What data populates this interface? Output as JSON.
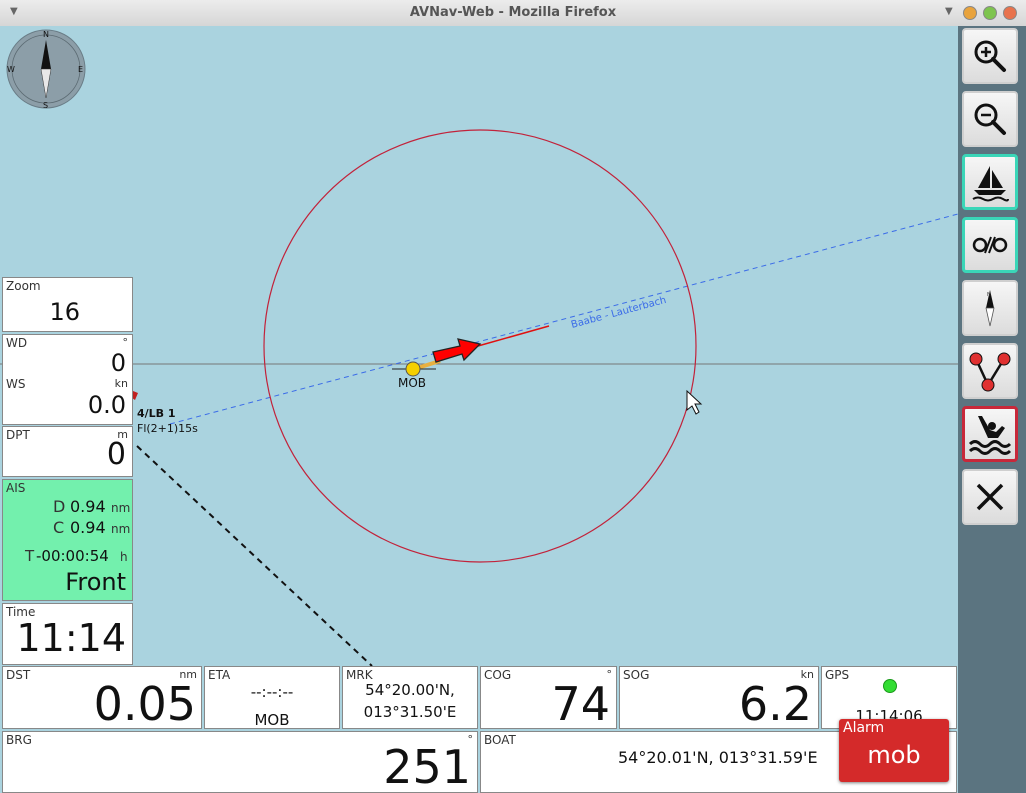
{
  "window": {
    "title": "AVNav-Web - Mozilla Firefox"
  },
  "map": {
    "route_label": "Baabe - Lauterbach",
    "mob_label": "MOB",
    "buoy_name": "4/LB 1",
    "buoy_light": "Fl(2+1)15s",
    "compass_letters": {
      "n": "N",
      "e": "E",
      "s": "S",
      "w": "W"
    },
    "colors": {
      "water": "#aad3df",
      "circle": "#c2223a",
      "route": "#3b6ce8",
      "boat": "#ff0000",
      "mob": "#f5d000"
    }
  },
  "toolbar": [
    {
      "icon": "zoom-in-icon",
      "state": "normal"
    },
    {
      "icon": "zoom-out-icon",
      "state": "normal"
    },
    {
      "icon": "boat-icon",
      "state": "active"
    },
    {
      "icon": "lock-boat-icon",
      "state": "active"
    },
    {
      "icon": "compass-icon",
      "state": "normal"
    },
    {
      "icon": "route-icon",
      "state": "normal"
    },
    {
      "icon": "man-overboard-icon",
      "state": "alarm"
    },
    {
      "icon": "close-icon",
      "state": "normal"
    }
  ],
  "widgets": {
    "zoom": {
      "label": "Zoom",
      "value": "16"
    },
    "wd": {
      "label": "WD",
      "unit": "°",
      "value": "0"
    },
    "ws": {
      "label": "WS",
      "unit": "kn",
      "value": "0.0"
    },
    "dpt": {
      "label": "DPT",
      "unit": "m",
      "value": "0"
    },
    "ais": {
      "label": "AIS",
      "d_label": "D",
      "d_value": "0.94",
      "d_unit": "nm",
      "c_label": "C",
      "c_value": "0.94",
      "c_unit": "nm",
      "t_label": "T",
      "t_value": "-00:00:54",
      "t_unit": "h",
      "front": "Front"
    },
    "time": {
      "label": "Time",
      "value": "11:14"
    },
    "dst": {
      "label": "DST",
      "unit": "nm",
      "value": "0.05"
    },
    "eta": {
      "label": "ETA",
      "value": "--:--:--",
      "target": "MOB"
    },
    "mrk": {
      "label": "MRK",
      "lat": "54°20.00'N,",
      "lon": "013°31.50'E"
    },
    "cog": {
      "label": "COG",
      "unit": "°",
      "value": "74"
    },
    "sog": {
      "label": "SOG",
      "unit": "kn",
      "value": "6.2"
    },
    "gps": {
      "label": "GPS",
      "value": "11:14:06",
      "status_color": "#33dd33"
    },
    "brg": {
      "label": "BRG",
      "unit": "°",
      "value": "251"
    },
    "boat": {
      "label": "BOAT",
      "value": "54°20.01'N, 013°31.59'E"
    }
  },
  "alarm": {
    "label": "Alarm",
    "value": "mob"
  }
}
